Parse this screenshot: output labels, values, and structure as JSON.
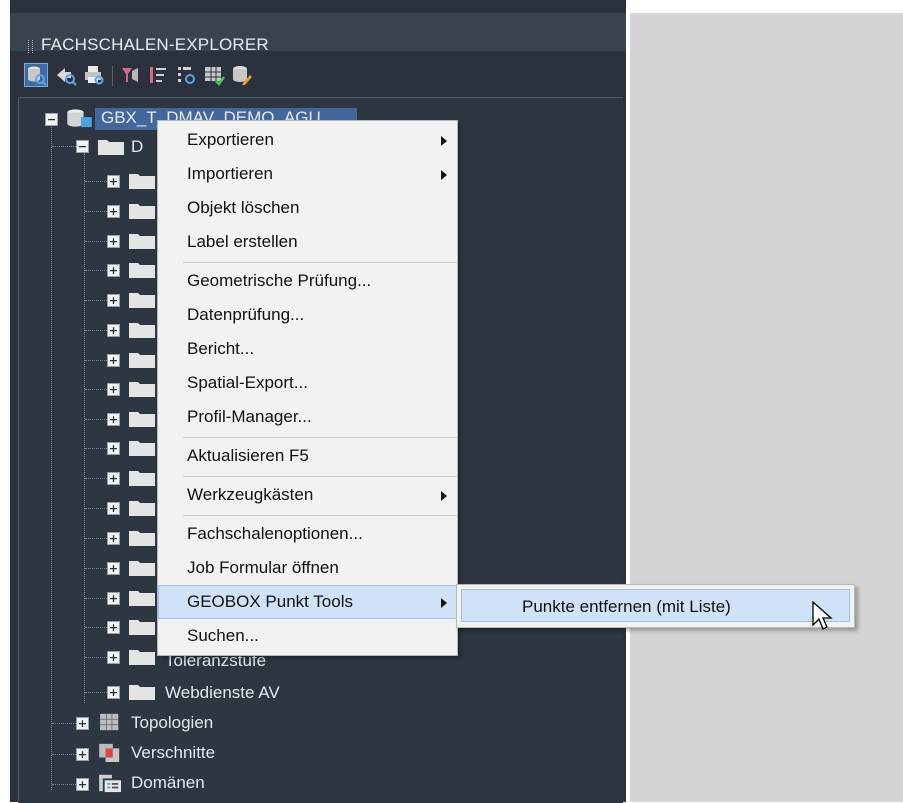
{
  "palette": {
    "title": "FACHSCHALEN-EXPLORER"
  },
  "toolbar": {
    "icons": [
      "database-search-icon",
      "pointer-search-icon",
      "printer-search-icon",
      "filter-icon",
      "sort-icon",
      "list-search-icon",
      "grid-check-icon",
      "database-edit-icon"
    ]
  },
  "tree": {
    "root_label": "GBX_T_DMAV_DEMO_AGU",
    "child_label_partial": "D",
    "items": [
      {
        "label": "Toleranzstufe"
      },
      {
        "label": "Webdienste AV"
      },
      {
        "label": "Topologien"
      },
      {
        "label": "Verschnitte"
      },
      {
        "label": "Domänen"
      }
    ]
  },
  "context_menu": {
    "items": [
      {
        "label": "Exportieren",
        "has_submenu": true
      },
      {
        "label": "Importieren",
        "has_submenu": true
      },
      {
        "label": "Objekt löschen"
      },
      {
        "label": "Label erstellen"
      },
      {
        "label": "Geometrische Prüfung..."
      },
      {
        "label": "Datenprüfung..."
      },
      {
        "label": "Bericht..."
      },
      {
        "label": "Spatial-Export..."
      },
      {
        "label": "Profil-Manager..."
      },
      {
        "label": "Aktualisieren F5"
      },
      {
        "label": "Werkzeugkästen",
        "has_submenu": true
      },
      {
        "label": "Fachschalenoptionen..."
      },
      {
        "label": "Job Formular öffnen"
      },
      {
        "label": "GEOBOX Punkt Tools",
        "has_submenu": true,
        "highlighted": true
      },
      {
        "label": "Suchen..."
      }
    ]
  },
  "submenu": {
    "item_label": "Punkte entfernen (mit Liste)"
  },
  "colors": {
    "palette_bg": "#2b323d",
    "selection": "#43679a",
    "menu_bg": "#f2f2f2",
    "menu_highlight": "#cfe2f7"
  }
}
